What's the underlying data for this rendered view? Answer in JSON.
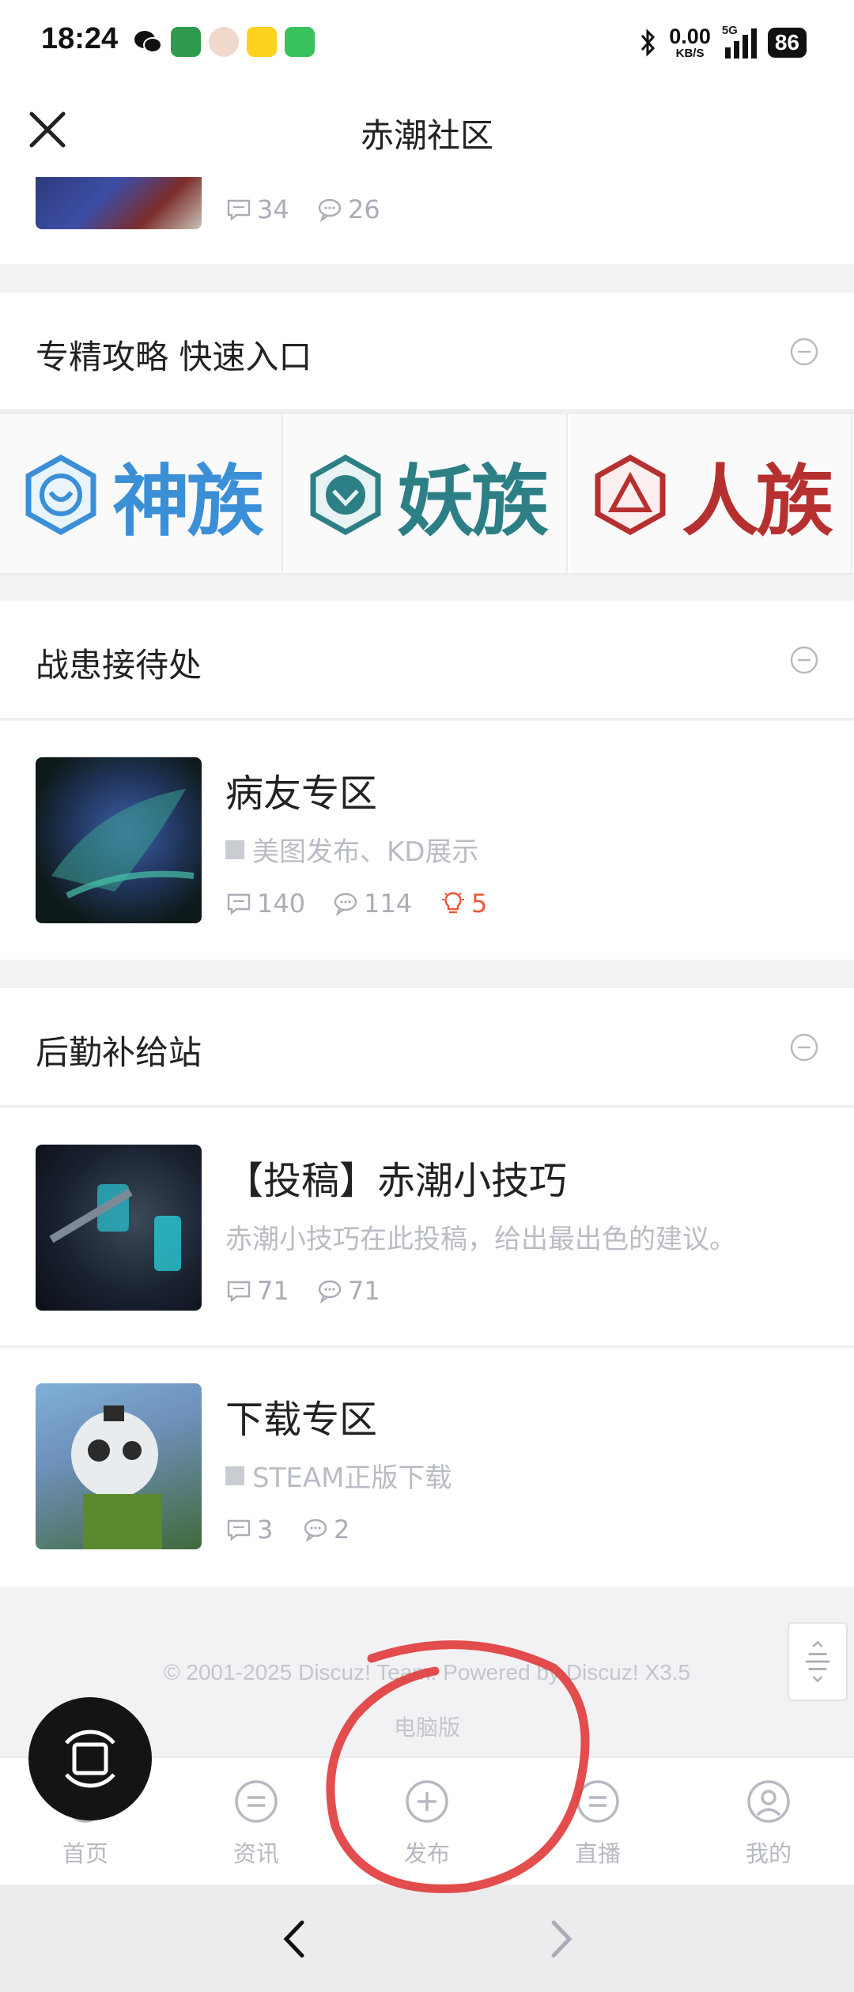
{
  "status_bar": {
    "time": "18:24",
    "net_speed": "0.00",
    "net_unit": "KB/S",
    "signal": "5G",
    "battery": "86"
  },
  "nav": {
    "title": "赤潮社区"
  },
  "top_card": {
    "replies": "34",
    "comments": "26"
  },
  "quick_entry": {
    "title": "专精攻略 快速入口",
    "races": [
      {
        "label": "神族",
        "color": "#3b8fd6"
      },
      {
        "label": "妖族",
        "color": "#2d7f86"
      },
      {
        "label": "人族",
        "color": "#b73030"
      }
    ]
  },
  "section_patients": {
    "title": "战患接待处",
    "forums": [
      {
        "title": "病友专区",
        "desc": "美图发布、KD展示",
        "replies": "140",
        "comments": "114",
        "hot": "5"
      }
    ]
  },
  "section_supply": {
    "title": "后勤补给站",
    "forums": [
      {
        "title": "【投稿】赤潮小技巧",
        "desc": "赤潮小技巧在此投稿，给出最出色的建议。",
        "replies": "71",
        "comments": "71"
      },
      {
        "title": "下载专区",
        "desc": "STEAM正版下载",
        "replies": "3",
        "comments": "2"
      }
    ]
  },
  "footer": {
    "copyright": "© 2001-2025 Discuz! Team. Powered by Discuz! X3.5",
    "pc_version": "电脑版"
  },
  "tabbar": [
    {
      "label": "首页",
      "icon": "home-icon"
    },
    {
      "label": "资讯",
      "icon": "news-icon"
    },
    {
      "label": "发布",
      "icon": "add-circle-icon"
    },
    {
      "label": "直播",
      "icon": "live-icon"
    },
    {
      "label": "我的",
      "icon": "profile-icon"
    }
  ],
  "colors": {
    "accent_hot": "#e8593a",
    "annotation": "#e03a3a",
    "muted": "#a9adb6"
  }
}
